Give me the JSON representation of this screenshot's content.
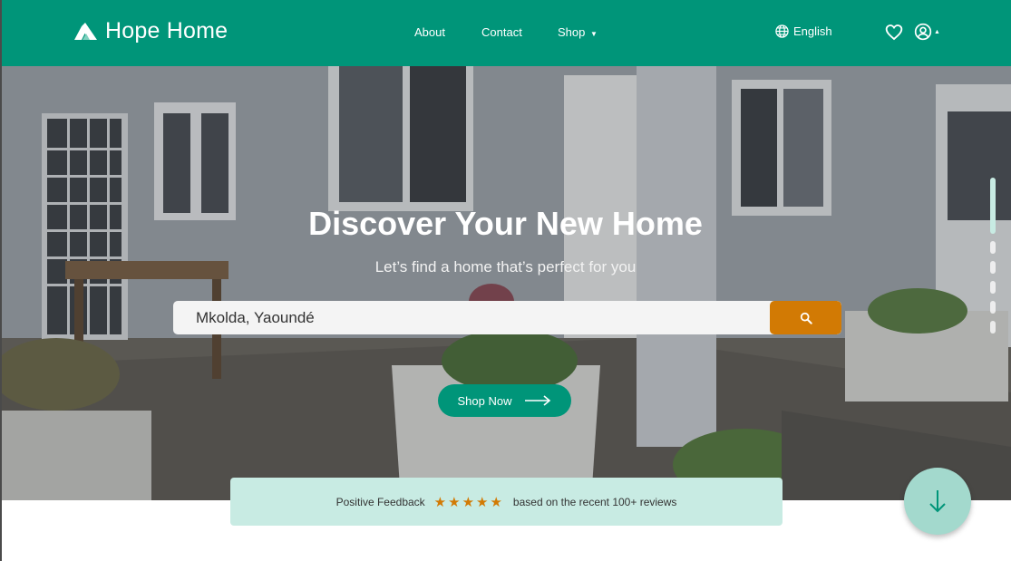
{
  "brand": {
    "name": "Hope Home"
  },
  "nav": {
    "links": [
      {
        "label": "About"
      },
      {
        "label": "Contact"
      },
      {
        "label": "Shop"
      }
    ],
    "language": "English"
  },
  "hero": {
    "title": "Discover Your New Home",
    "subtitle": "Let’s find a home that’s perfect for you",
    "search_value": "Mkolda, Yaoundé",
    "cta_label": "Shop Now",
    "carousel_slides": 6,
    "carousel_active_index": 0
  },
  "feedback": {
    "label": "Positive Feedback",
    "stars": "★★★★★",
    "rating": 5,
    "reviews_text": "based on the recent 100+ reviews"
  },
  "colors": {
    "brand_green": "#009579",
    "accent_orange": "#d27a04",
    "feedback_bg": "#c8ebe3"
  },
  "icons": [
    "logo-icon",
    "globe-icon",
    "heart-icon",
    "user-icon",
    "caret-up-icon",
    "caret-down-icon",
    "search-icon",
    "arrow-right-icon",
    "arrow-down-icon"
  ]
}
